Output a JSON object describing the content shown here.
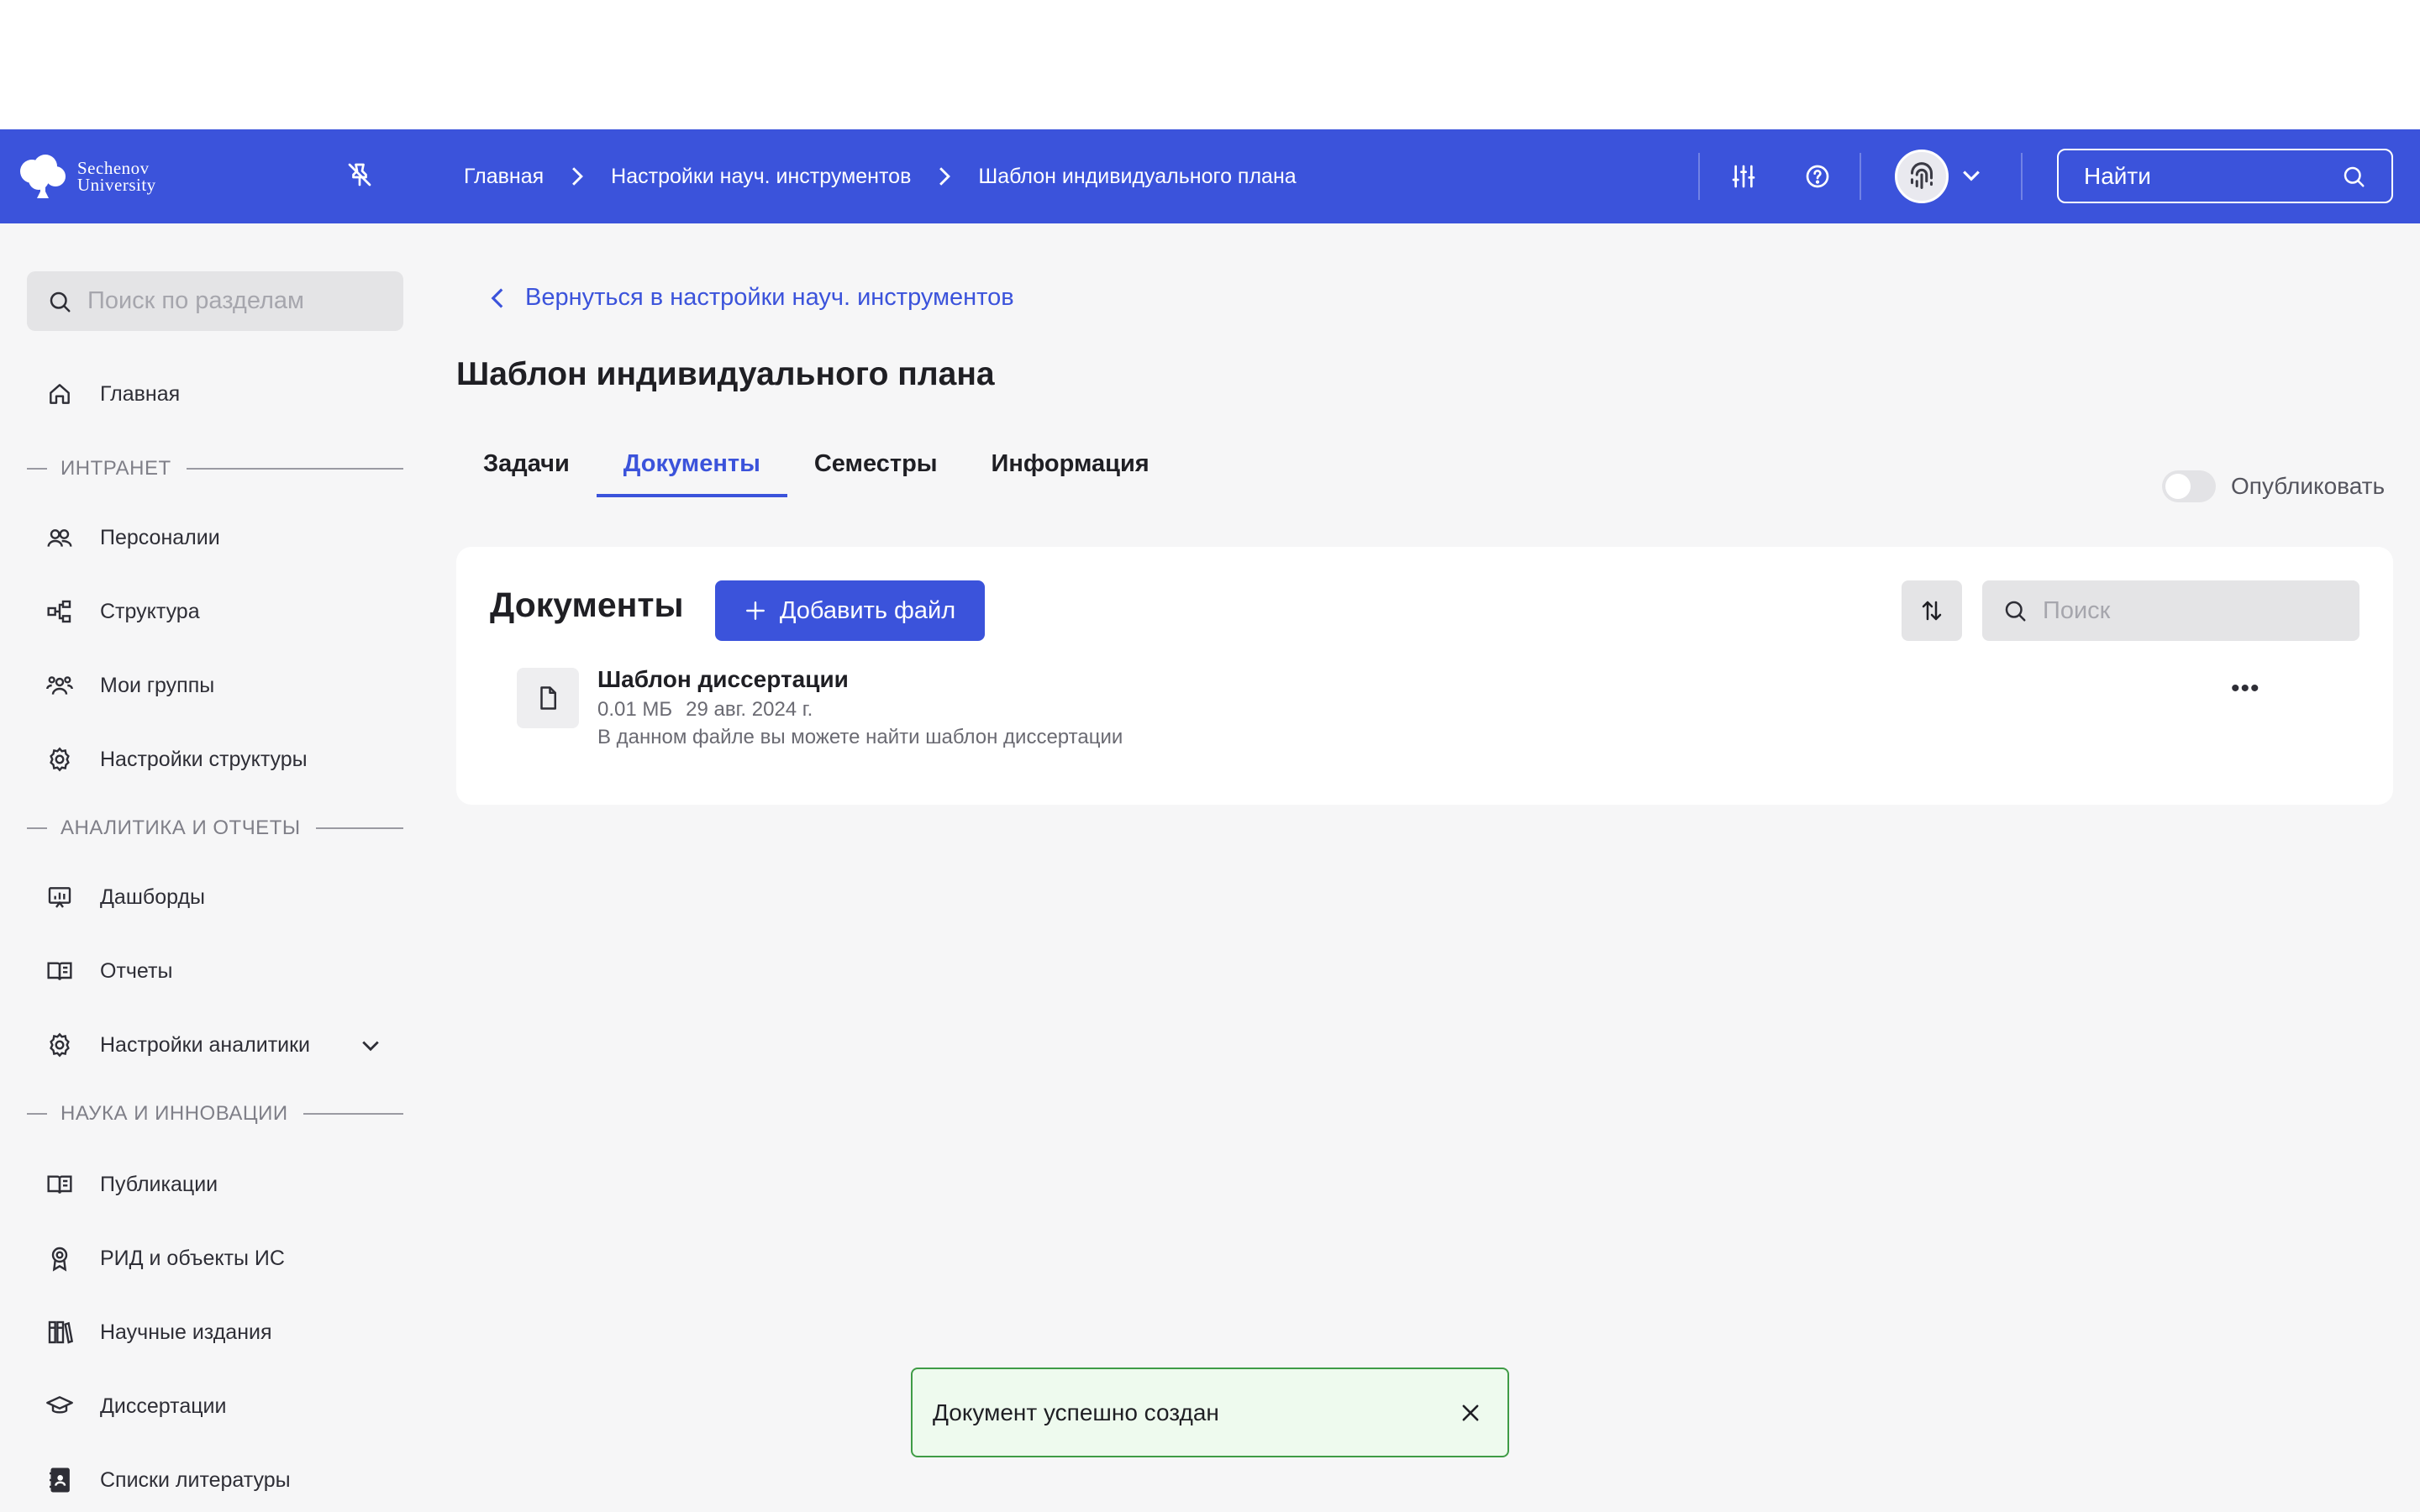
{
  "header": {
    "logo_line1": "Sechenov",
    "logo_line2": "University",
    "breadcrumbs": [
      "Главная",
      "Настройки науч. инструментов",
      "Шаблон индивидуального плана"
    ],
    "search_label": "Найти"
  },
  "sidebar": {
    "search_placeholder": "Поиск по разделам",
    "home": "Главная",
    "sections": [
      {
        "title": "ИНТРАНЕТ",
        "items": [
          "Персоналии",
          "Структура",
          "Мои группы",
          "Настройки структуры"
        ]
      },
      {
        "title": "АНАЛИТИКА И ОТЧЕТЫ",
        "items": [
          "Дашборды",
          "Отчеты",
          "Настройки аналитики"
        ]
      },
      {
        "title": "НАУКА И ИННОВАЦИИ",
        "items": [
          "Публикации",
          "РИД и объекты ИС",
          "Научные издания",
          "Диссертации",
          "Списки литературы"
        ]
      }
    ]
  },
  "main": {
    "back_link": "Вернуться в настройки науч. инструментов",
    "page_title": "Шаблон индивидуального плана",
    "tabs": [
      "Задачи",
      "Документы",
      "Семестры",
      "Информация"
    ],
    "active_tab": "Документы",
    "publish_label": "Опубликовать",
    "publish_enabled": false
  },
  "documents": {
    "title": "Документы",
    "add_button": "Добавить файл",
    "search_placeholder": "Поиск",
    "files": [
      {
        "name": "Шаблон диссертации",
        "size": "0.01 МБ",
        "date": "29 авг. 2024 г.",
        "description": "В данном файле вы можете найти шаблон диссертации"
      }
    ]
  },
  "toast": {
    "message": "Документ успешно создан"
  },
  "colors": {
    "accent": "#3b53db",
    "background": "#f6f6f7",
    "success_border": "#3f9c46",
    "success_bg": "#eefaee"
  }
}
